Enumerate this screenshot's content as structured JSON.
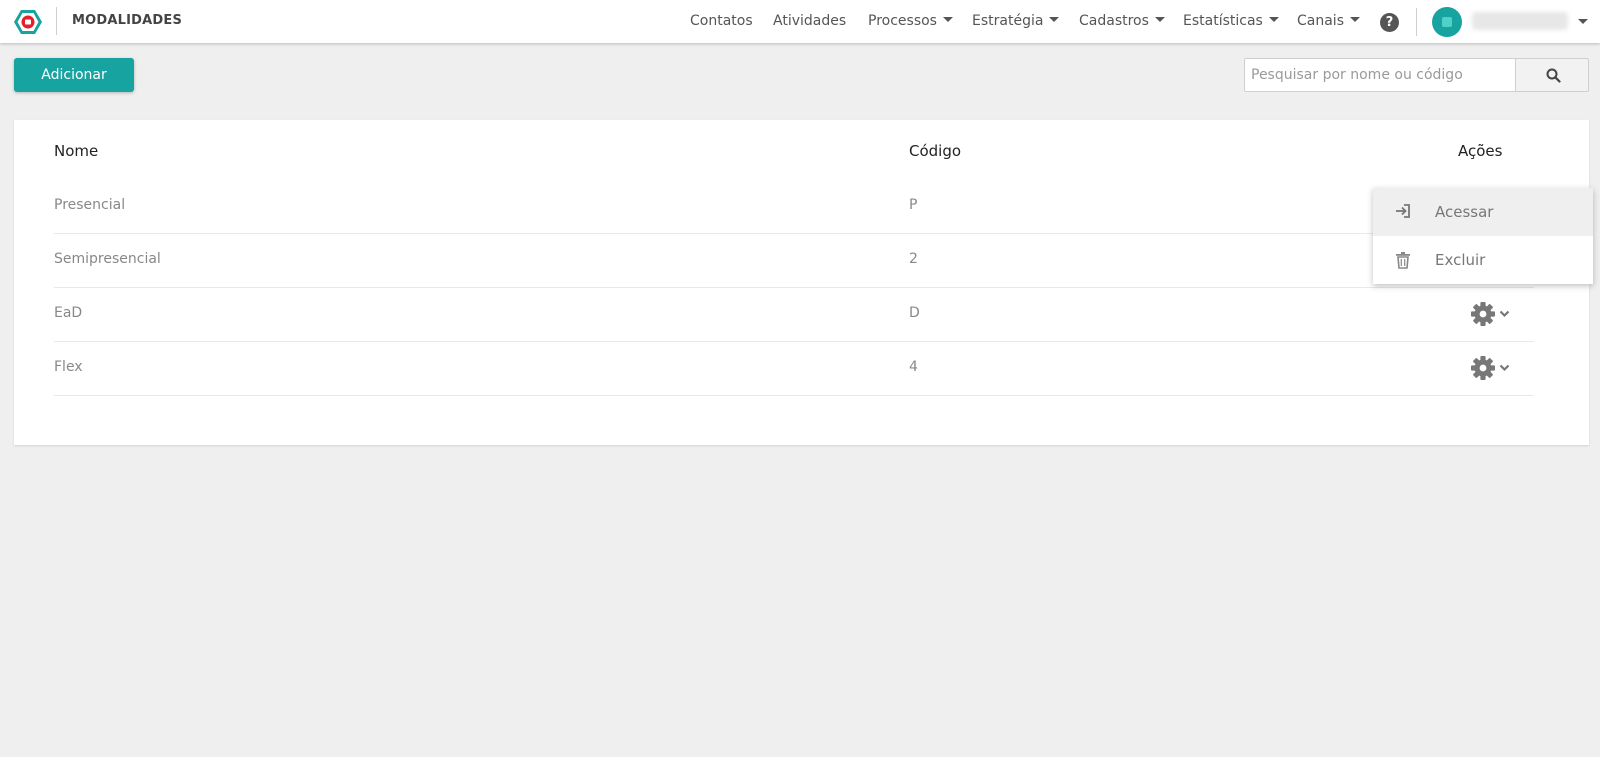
{
  "header": {
    "page_title": "MODALIDADES",
    "nav": [
      {
        "label": "Contatos",
        "has_dropdown": false
      },
      {
        "label": "Atividades",
        "has_dropdown": false
      },
      {
        "label": "Processos",
        "has_dropdown": true
      },
      {
        "label": "Estratégia",
        "has_dropdown": true
      },
      {
        "label": "Cadastros",
        "has_dropdown": true
      },
      {
        "label": "Estatísticas",
        "has_dropdown": true
      },
      {
        "label": "Canais",
        "has_dropdown": true
      }
    ],
    "help_glyph": "?"
  },
  "toolbar": {
    "add_label": "Adicionar",
    "search_placeholder": "Pesquisar por nome ou código"
  },
  "table": {
    "columns": {
      "name": "Nome",
      "code": "Código",
      "actions": "Ações"
    },
    "rows": [
      {
        "name": "Presencial",
        "code": "P"
      },
      {
        "name": "Semipresencial",
        "code": "2"
      },
      {
        "name": "EaD",
        "code": "D"
      },
      {
        "name": "Flex",
        "code": "4"
      }
    ]
  },
  "actions_menu": {
    "items": [
      {
        "label": "Acessar",
        "icon": "sign-in-icon"
      },
      {
        "label": "Excluir",
        "icon": "trash-icon"
      }
    ]
  },
  "colors": {
    "accent": "#17a3a0",
    "logo_red": "#e5202a",
    "background": "#efefef"
  }
}
